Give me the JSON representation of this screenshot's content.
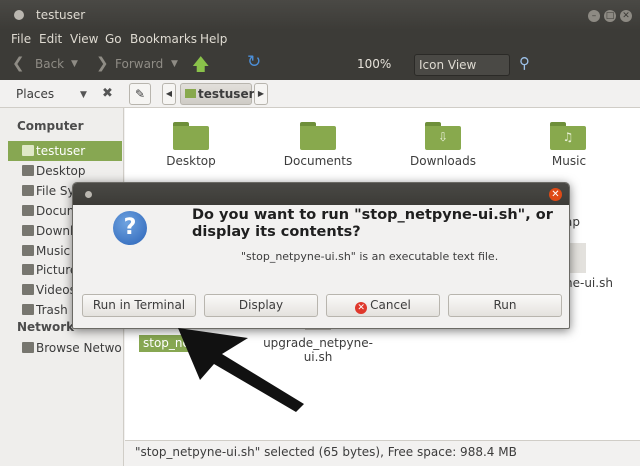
{
  "window": {
    "title": "testuser"
  },
  "menu": [
    "File",
    "Edit",
    "View",
    "Go",
    "Bookmarks",
    "Help"
  ],
  "toolbar": {
    "back": "Back",
    "forward": "Forward",
    "zoom": "100%",
    "view": "Icon View"
  },
  "location": {
    "sidebar_mode": "Places",
    "crumb": "testuser"
  },
  "sidebar": {
    "computer_heading": "Computer",
    "items": [
      "testuser",
      "Desktop",
      "File System",
      "Documents",
      "Downloads",
      "Music",
      "Pictures",
      "Videos",
      "Trash"
    ],
    "network_heading": "Network",
    "network_items": [
      "Browse Network"
    ]
  },
  "content": {
    "folders": [
      "Desktop",
      "Documents",
      "Downloads",
      "Music"
    ],
    "partial_right_1": "ap",
    "partial_right_2": "ne-ui.sh",
    "selected_file": "stop_ne",
    "file2_line1": "upgrade_netpyne-",
    "file2_line2": "ui.sh"
  },
  "status": "\"stop_netpyne-ui.sh\" selected (65 bytes), Free space: 988.4 MB",
  "dialog": {
    "heading": "Do you want to run \"stop_netpyne-ui.sh\", or display its contents?",
    "subtext": "\"stop_netpyne-ui.sh\" is an executable text file.",
    "btn_run_terminal": "Run in Terminal",
    "btn_display": "Display",
    "btn_cancel": "Cancel",
    "btn_run": "Run"
  },
  "colors": {
    "accent": "#87a752",
    "titlebar": "#3c3b37",
    "close": "#df4a16"
  }
}
